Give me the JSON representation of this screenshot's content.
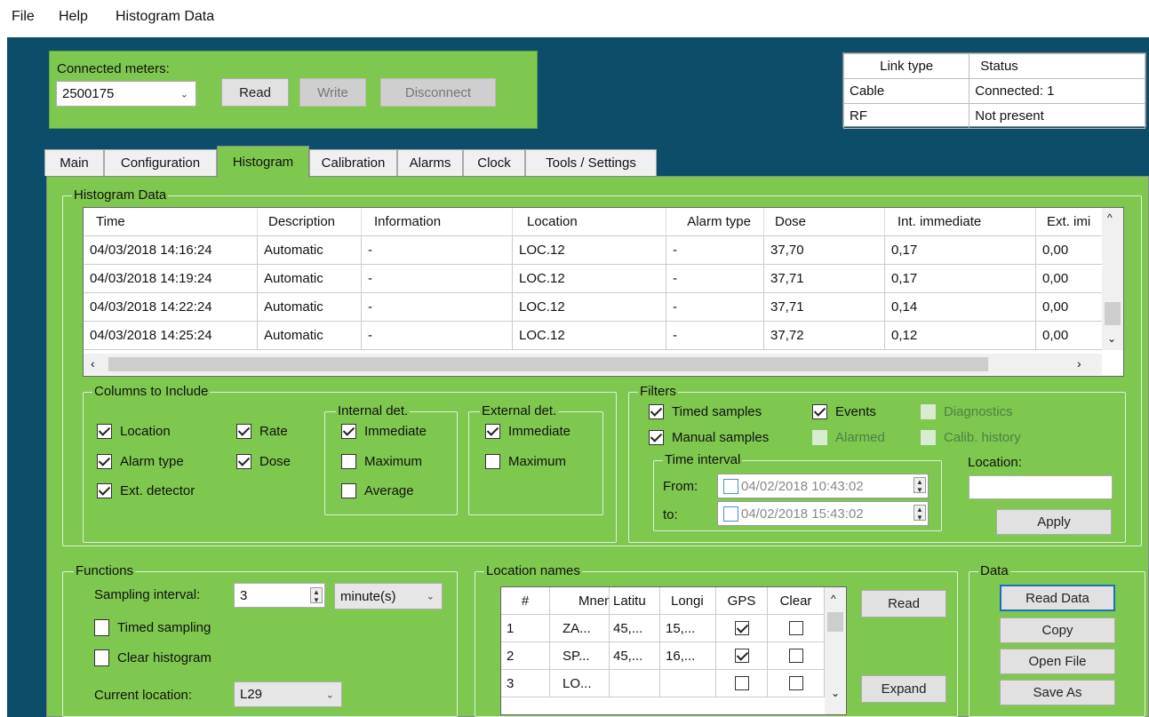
{
  "menu": [
    "File",
    "Help",
    "Histogram Data"
  ],
  "meters": {
    "label": "Connected meters:",
    "selected": "2500175",
    "read_label": "Read",
    "write_label": "Write",
    "disconnect_label": "Disconnect"
  },
  "link_table": {
    "headers": [
      "Link type",
      "Status"
    ],
    "rows": [
      [
        "Cable",
        "Connected: 1"
      ],
      [
        "RF",
        "Not present"
      ]
    ]
  },
  "tabs": [
    "Main",
    "Configuration",
    "Histogram",
    "Calibration",
    "Alarms",
    "Clock",
    "Tools / Settings"
  ],
  "active_tab": "Histogram",
  "histogram": {
    "group_label": "Histogram Data",
    "columns": [
      "Time",
      "Description",
      "Information",
      "Location",
      "Alarm type",
      "Dose",
      "Int. immediate",
      "Ext. imi"
    ],
    "rows": [
      [
        "04/03/2018 14:16:24",
        "Automatic",
        "-",
        "LOC.12",
        "-",
        "37,70",
        "0,17",
        "0,00"
      ],
      [
        "04/03/2018 14:19:24",
        "Automatic",
        "-",
        "LOC.12",
        "-",
        "37,71",
        "0,17",
        "0,00"
      ],
      [
        "04/03/2018 14:22:24",
        "Automatic",
        "-",
        "LOC.12",
        "-",
        "37,71",
        "0,14",
        "0,00"
      ],
      [
        "04/03/2018 14:25:24",
        "Automatic",
        "-",
        "LOC.12",
        "-",
        "37,72",
        "0,12",
        "0,00"
      ]
    ]
  },
  "columns_to_include": {
    "label": "Columns to Include",
    "location": "Location",
    "rate": "Rate",
    "alarm_type": "Alarm type",
    "dose": "Dose",
    "ext_detector": "Ext. detector",
    "internal_label": "Internal det.",
    "internal_immediate": "Immediate",
    "internal_maximum": "Maximum",
    "internal_average": "Average",
    "external_label": "External det.",
    "external_immediate": "Immediate",
    "external_maximum": "Maximum"
  },
  "filters": {
    "label": "Filters",
    "timed_samples": "Timed samples",
    "events": "Events",
    "diagnostics": "Diagnostics",
    "manual_samples": "Manual samples",
    "alarmed": "Alarmed",
    "calib_history": "Calib. history",
    "time_interval_label": "Time interval",
    "from_label": "From:",
    "from_value": "04/02/2018 10:43:02",
    "to_label": "to:",
    "to_value": "04/02/2018 15:43:02",
    "location_label": "Location:",
    "location_value": "",
    "apply_label": "Apply"
  },
  "functions": {
    "label": "Functions",
    "sampling_label": "Sampling interval:",
    "sampling_value": "3",
    "unit": "minute(s)",
    "timed_sampling": "Timed sampling",
    "clear_histogram": "Clear histogram",
    "current_location_label": "Current location:",
    "current_location_value": "L29"
  },
  "location_names": {
    "label": "Location names",
    "columns": [
      "#",
      "Mnen",
      "Latitu",
      "Longi",
      "GPS",
      "Clear"
    ],
    "rows": [
      {
        "num": "1",
        "mnem": "ZA...",
        "lat": "45,...",
        "lon": "15,...",
        "gps": true,
        "clear": false
      },
      {
        "num": "2",
        "mnem": "SP...",
        "lat": "45,...",
        "lon": "16,...",
        "gps": true,
        "clear": false
      },
      {
        "num": "3",
        "mnem": "LO...",
        "lat": "",
        "lon": "",
        "gps": false,
        "clear": false
      }
    ],
    "read_label": "Read",
    "expand_label": "Expand"
  },
  "data_panel": {
    "label": "Data",
    "read_data": "Read Data",
    "copy": "Copy",
    "open_file": "Open File",
    "save_as": "Save As"
  }
}
